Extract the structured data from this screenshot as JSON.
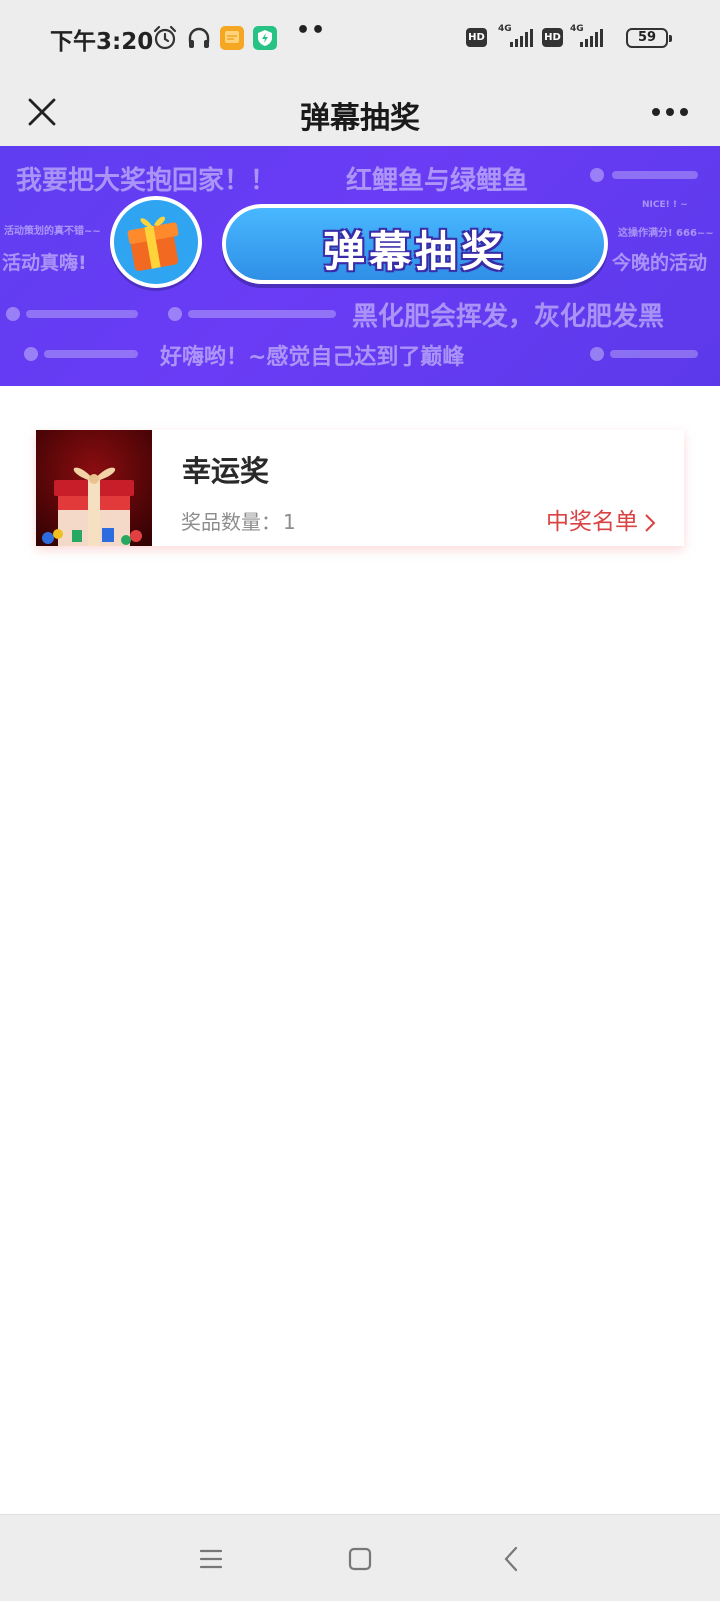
{
  "status_bar": {
    "time": "下午3:20",
    "network_label_1": "4G",
    "network_label_2": "4G",
    "hd_label_1": "HD",
    "hd_label_2": "HD",
    "battery": "59",
    "icons": [
      "alarm-clock-icon",
      "headphones-icon",
      "notes-app-icon",
      "security-app-icon",
      "more-dots-icon"
    ]
  },
  "title_bar": {
    "title": "弹幕抽奖",
    "close_icon": "close-icon",
    "more_icon": "more-icon"
  },
  "banner": {
    "main_text": "弹幕抽奖",
    "danmaku": [
      "我要把大奖抱回家！！",
      "红鲤鱼与绿鲤鱼",
      "活动策划的真不错~~",
      "活动真嗨!",
      "NICE! ! ~",
      "这操作满分! 666~~",
      "今晚的活动",
      "黑化肥会挥发，灰化肥发黑",
      "好嗨哟！~感觉自己达到了巅峰"
    ]
  },
  "prizes": [
    {
      "name": "幸运奖",
      "quantity_label": "奖品数量：",
      "quantity": "1",
      "winners_link": "中奖名单"
    }
  ],
  "colors": {
    "banner_purple": "#6a3cf5",
    "accent_red": "#d94343",
    "bar_gray": "#ededed"
  }
}
